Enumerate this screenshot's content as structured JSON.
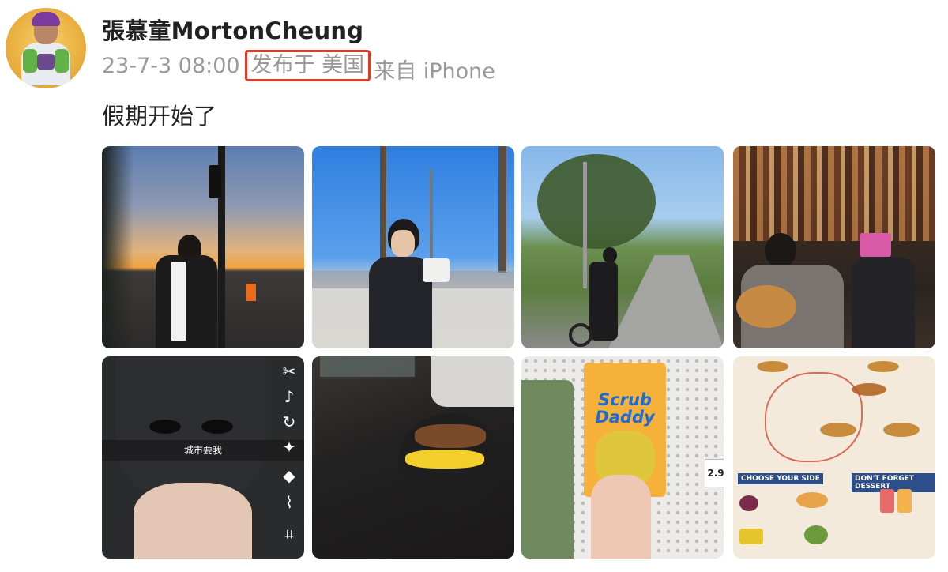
{
  "post": {
    "username": "張慕童MortonCheung",
    "date": "23-7-3 08:00",
    "location": "发布于 美国",
    "source": "来自 iPhone",
    "text": "假期开始了"
  },
  "photos": [
    {
      "subject": "sunset street"
    },
    {
      "subject": "palm trees sunny lot"
    },
    {
      "subject": "park path scooter"
    },
    {
      "subject": "guitar shop"
    },
    {
      "subject": "batman mask selfie",
      "caption": "城市要我"
    },
    {
      "subject": "food plate"
    },
    {
      "subject": "scrub daddy sponge",
      "brand_top": "Scrub",
      "brand_bottom": "Daddy",
      "price": "2.9"
    },
    {
      "subject": "menu with drawing",
      "section_choose": "CHOOSE YOUR SIDE",
      "section_dessert": "DON'T FORGET DESSERT"
    }
  ],
  "colors": {
    "username": "#222222",
    "meta": "#999999",
    "location_highlight": "#e03a2a"
  },
  "icons": [
    "scissors-icon",
    "music-icon",
    "rotate-icon",
    "magic-wand-icon",
    "eraser-icon",
    "paperclip-icon",
    "crop-icon"
  ]
}
